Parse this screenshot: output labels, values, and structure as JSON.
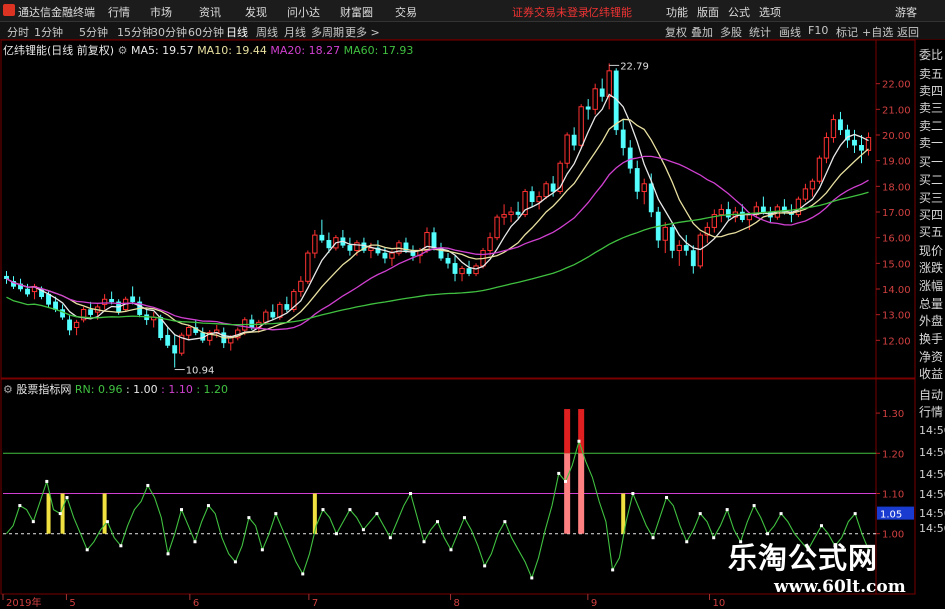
{
  "menubar": {
    "app_title": "通达信金融终端",
    "items": [
      "行情",
      "市场",
      "资讯",
      "发现",
      "问小达",
      "财富圈",
      "交易"
    ],
    "warning": "证券交易未登录",
    "warning2": "亿纬锂能",
    "right_items": [
      "功能",
      "版面",
      "公式",
      "选项"
    ],
    "guest": "游客"
  },
  "toolbar": {
    "periods": [
      "分时",
      "1分钟",
      "5分钟",
      "15分钟",
      "30分钟",
      "60分钟",
      "日线",
      "周线",
      "月线",
      "多周期",
      "更多 >"
    ],
    "active_period": "日线",
    "tools": [
      "复权",
      "叠加",
      "多股",
      "统计",
      "画线",
      "F10",
      "标记",
      "+自选",
      "返回"
    ]
  },
  "main_legend": {
    "stock": "亿纬锂能",
    "mode": "(日线 前复权)",
    "ma": [
      {
        "label": "MA5: 19.57",
        "color": "#e8e8e8"
      },
      {
        "label": "MA10: 19.44",
        "color": "#e8e0a0"
      },
      {
        "label": "MA20: 18.27",
        "color": "#d040d0"
      },
      {
        "label": "MA60: 17.93",
        "color": "#40c040"
      }
    ]
  },
  "sub_legend": {
    "name": "股票指标网",
    "values": [
      {
        "label": "RN: 0.96",
        "color": "#40c040"
      },
      {
        "label": ": 1.00",
        "color": "#e8e8e8"
      },
      {
        "label": ": 1.10",
        "color": "#d040d0"
      },
      {
        "label": ": 1.20",
        "color": "#40c040"
      }
    ]
  },
  "right_panel": {
    "items": [
      "委比",
      "卖五",
      "卖四",
      "卖三",
      "卖二",
      "卖一",
      "买一",
      "买二",
      "买三",
      "买四",
      "买五",
      "现价",
      "涨跌",
      "涨幅",
      "总量",
      "外盘",
      "换手",
      "净资",
      "收益"
    ],
    "items2": [
      "自动",
      "行情"
    ],
    "times": [
      "14:50",
      "14:50",
      "14:50",
      "14:50",
      "14:50",
      "14:50"
    ]
  },
  "watermark": {
    "line1": "乐淘公式网",
    "line2": "www.60lt.com"
  },
  "chart_data": [
    {
      "type": "candlestick",
      "title": "亿纬锂能 (日线 前复权)",
      "y_axis_ticks": [
        12.0,
        13.0,
        14.0,
        15.0,
        16.0,
        17.0,
        18.0,
        19.0,
        20.0,
        21.0,
        22.0
      ],
      "ylim": [
        11.0,
        23.0
      ],
      "x_labels": [
        "2019年",
        "5",
        "6",
        "7",
        "8",
        "9",
        "10"
      ],
      "annotations": [
        {
          "label": "22.79",
          "value": 22.79
        },
        {
          "label": "10.94",
          "value": 10.94
        }
      ],
      "ohlc": [
        [
          14.5,
          14.7,
          14.2,
          14.4
        ],
        [
          14.3,
          14.5,
          14.0,
          14.1
        ],
        [
          14.2,
          14.4,
          13.9,
          14.0
        ],
        [
          14.0,
          14.2,
          13.7,
          13.8
        ],
        [
          13.9,
          14.2,
          13.6,
          14.1
        ],
        [
          14.0,
          14.1,
          13.6,
          13.7
        ],
        [
          13.8,
          13.9,
          13.3,
          13.4
        ],
        [
          13.5,
          13.7,
          13.1,
          13.2
        ],
        [
          13.2,
          13.4,
          12.8,
          12.9
        ],
        [
          12.8,
          13.0,
          12.2,
          12.4
        ],
        [
          12.5,
          12.8,
          12.2,
          12.7
        ],
        [
          12.8,
          13.3,
          12.7,
          13.2
        ],
        [
          13.2,
          13.5,
          12.9,
          13.0
        ],
        [
          13.1,
          13.4,
          12.8,
          13.3
        ],
        [
          13.4,
          13.8,
          13.2,
          13.6
        ],
        [
          13.6,
          13.9,
          13.4,
          13.5
        ],
        [
          13.5,
          13.6,
          13.0,
          13.1
        ],
        [
          13.2,
          13.7,
          13.1,
          13.6
        ],
        [
          13.7,
          14.1,
          13.4,
          13.5
        ],
        [
          13.5,
          13.7,
          12.9,
          13.0
        ],
        [
          13.0,
          13.2,
          12.6,
          12.8
        ],
        [
          12.8,
          13.1,
          12.5,
          12.9
        ],
        [
          12.9,
          13.0,
          12.0,
          12.1
        ],
        [
          12.2,
          12.5,
          11.7,
          11.8
        ],
        [
          11.8,
          12.2,
          10.94,
          11.5
        ],
        [
          11.5,
          12.3,
          11.4,
          12.2
        ],
        [
          12.2,
          12.6,
          12.0,
          12.5
        ],
        [
          12.5,
          12.8,
          12.2,
          12.3
        ],
        [
          12.3,
          12.5,
          11.9,
          12.0
        ],
        [
          12.0,
          12.4,
          11.8,
          12.3
        ],
        [
          12.3,
          12.6,
          12.1,
          12.4
        ],
        [
          12.3,
          12.5,
          11.7,
          11.9
        ],
        [
          11.9,
          12.2,
          11.6,
          12.1
        ],
        [
          12.1,
          12.5,
          12.0,
          12.4
        ],
        [
          12.4,
          12.9,
          12.2,
          12.8
        ],
        [
          12.8,
          13.0,
          12.4,
          12.5
        ],
        [
          12.5,
          12.8,
          12.3,
          12.7
        ],
        [
          12.7,
          13.2,
          12.6,
          13.1
        ],
        [
          13.1,
          13.4,
          12.8,
          12.9
        ],
        [
          12.9,
          13.5,
          12.8,
          13.4
        ],
        [
          13.4,
          13.7,
          13.1,
          13.2
        ],
        [
          13.2,
          14.0,
          13.1,
          13.9
        ],
        [
          13.9,
          14.5,
          13.7,
          14.3
        ],
        [
          14.3,
          15.5,
          14.2,
          15.4
        ],
        [
          15.4,
          16.3,
          15.2,
          16.1
        ],
        [
          16.1,
          16.7,
          15.8,
          15.9
        ],
        [
          15.9,
          16.2,
          15.4,
          15.6
        ],
        [
          15.6,
          16.1,
          15.5,
          16.0
        ],
        [
          16.0,
          16.3,
          15.6,
          15.7
        ],
        [
          15.7,
          16.0,
          15.3,
          15.5
        ],
        [
          15.5,
          15.9,
          15.3,
          15.8
        ],
        [
          15.8,
          16.0,
          15.4,
          15.5
        ],
        [
          15.5,
          15.8,
          15.2,
          15.6
        ],
        [
          15.6,
          15.9,
          15.3,
          15.4
        ],
        [
          15.4,
          15.6,
          15.0,
          15.2
        ],
        [
          15.2,
          15.5,
          14.9,
          15.4
        ],
        [
          15.4,
          15.9,
          15.3,
          15.8
        ],
        [
          15.8,
          16.0,
          15.4,
          15.5
        ],
        [
          15.5,
          15.7,
          15.1,
          15.3
        ],
        [
          15.3,
          15.6,
          15.0,
          15.5
        ],
        [
          15.5,
          16.4,
          15.4,
          16.2
        ],
        [
          16.2,
          16.4,
          15.5,
          15.6
        ],
        [
          15.6,
          15.8,
          15.1,
          15.2
        ],
        [
          15.2,
          15.4,
          14.8,
          15.0
        ],
        [
          15.0,
          15.3,
          14.3,
          14.6
        ],
        [
          14.6,
          14.9,
          14.3,
          14.8
        ],
        [
          14.8,
          15.1,
          14.5,
          14.6
        ],
        [
          14.6,
          15.0,
          14.5,
          14.9
        ],
        [
          14.9,
          15.6,
          14.8,
          15.5
        ],
        [
          15.5,
          16.2,
          15.3,
          16.0
        ],
        [
          16.0,
          16.9,
          15.9,
          16.8
        ],
        [
          16.8,
          17.3,
          16.5,
          16.9
        ],
        [
          16.9,
          17.2,
          16.6,
          17.0
        ],
        [
          17.0,
          17.4,
          16.7,
          16.9
        ],
        [
          16.9,
          17.9,
          16.8,
          17.8
        ],
        [
          17.8,
          18.0,
          17.2,
          17.4
        ],
        [
          17.4,
          17.8,
          17.1,
          17.6
        ],
        [
          17.6,
          18.2,
          17.5,
          18.1
        ],
        [
          18.1,
          18.4,
          17.6,
          17.8
        ],
        [
          17.8,
          19.0,
          17.7,
          18.9
        ],
        [
          18.9,
          20.1,
          18.7,
          20.0
        ],
        [
          20.0,
          20.3,
          19.4,
          19.6
        ],
        [
          19.6,
          21.2,
          19.5,
          21.1
        ],
        [
          21.1,
          21.4,
          20.6,
          21.0
        ],
        [
          21.0,
          22.0,
          20.8,
          21.8
        ],
        [
          21.8,
          22.2,
          21.3,
          21.5
        ],
        [
          21.5,
          22.79,
          21.0,
          22.5
        ],
        [
          22.5,
          22.6,
          20.0,
          20.2
        ],
        [
          20.2,
          20.6,
          19.2,
          19.5
        ],
        [
          19.5,
          19.8,
          18.5,
          18.7
        ],
        [
          18.7,
          19.0,
          17.5,
          17.8
        ],
        [
          17.8,
          18.3,
          17.3,
          18.1
        ],
        [
          18.1,
          18.5,
          16.8,
          17.0
        ],
        [
          17.0,
          17.2,
          15.6,
          15.9
        ],
        [
          15.9,
          16.6,
          15.4,
          16.4
        ],
        [
          16.4,
          16.5,
          15.2,
          15.5
        ],
        [
          15.5,
          15.9,
          14.9,
          15.7
        ],
        [
          15.7,
          16.1,
          15.3,
          15.5
        ],
        [
          15.5,
          15.7,
          14.6,
          14.9
        ],
        [
          14.9,
          16.2,
          14.8,
          16.1
        ],
        [
          16.1,
          16.6,
          15.8,
          16.4
        ],
        [
          16.4,
          17.1,
          16.2,
          16.9
        ],
        [
          16.9,
          17.3,
          16.6,
          17.1
        ],
        [
          17.1,
          17.4,
          16.7,
          16.8
        ],
        [
          16.8,
          17.2,
          16.6,
          17.0
        ],
        [
          17.0,
          17.3,
          16.6,
          16.7
        ],
        [
          16.7,
          17.0,
          16.3,
          16.9
        ],
        [
          16.9,
          17.4,
          16.8,
          17.2
        ],
        [
          17.2,
          17.6,
          16.9,
          17.0
        ],
        [
          17.0,
          17.2,
          16.6,
          16.8
        ],
        [
          16.8,
          17.3,
          16.7,
          17.2
        ],
        [
          17.2,
          17.5,
          16.9,
          17.0
        ],
        [
          17.0,
          17.3,
          16.6,
          16.9
        ],
        [
          16.9,
          17.6,
          16.8,
          17.5
        ],
        [
          17.5,
          18.1,
          17.4,
          17.9
        ],
        [
          17.9,
          18.3,
          17.6,
          18.2
        ],
        [
          18.2,
          19.2,
          18.1,
          19.1
        ],
        [
          19.1,
          20.1,
          18.9,
          19.9
        ],
        [
          19.9,
          20.8,
          19.7,
          20.6
        ],
        [
          20.6,
          20.9,
          20.0,
          20.2
        ],
        [
          20.2,
          20.4,
          19.5,
          19.8
        ],
        [
          19.8,
          20.2,
          19.3,
          19.6
        ],
        [
          19.6,
          20.0,
          18.9,
          19.4
        ],
        [
          19.4,
          20.1,
          19.2,
          19.9
        ]
      ]
    },
    {
      "type": "line",
      "title": "股票指标网",
      "y_axis_ticks": [
        1.0,
        1.1,
        1.2,
        1.3
      ],
      "ylim": [
        0.86,
        1.34
      ],
      "hlines": [
        {
          "label": "1.00",
          "value": 1.0,
          "color": "#e8e8e8"
        },
        {
          "label": "1.10",
          "value": 1.1,
          "color": "#d040d0"
        },
        {
          "label": "1.20",
          "value": 1.2,
          "color": "#40c040"
        }
      ],
      "current_value_label": "1.05",
      "series": [
        {
          "name": "RN",
          "color": "#40c040",
          "values": [
            1.0,
            1.02,
            1.07,
            1.06,
            1.03,
            1.08,
            1.13,
            1.06,
            1.05,
            1.09,
            1.04,
            1.0,
            0.96,
            0.98,
            1.01,
            1.03,
            0.99,
            0.97,
            1.02,
            1.06,
            1.08,
            1.12,
            1.09,
            1.04,
            0.95,
            1.0,
            1.06,
            1.02,
            0.98,
            1.03,
            1.07,
            1.05,
            0.99,
            0.95,
            0.93,
            0.97,
            1.04,
            1.02,
            0.96,
            1.0,
            1.05,
            1.01,
            0.97,
            0.93,
            0.9,
            0.95,
            1.02,
            1.06,
            1.04,
            1.0,
            1.03,
            1.06,
            1.04,
            1.01,
            1.03,
            1.05,
            1.02,
            0.99,
            1.03,
            1.07,
            1.1,
            1.04,
            0.98,
            1.01,
            1.03,
            0.99,
            0.96,
            1.0,
            1.04,
            1.01,
            0.97,
            0.92,
            0.95,
            1.0,
            1.03,
            0.99,
            0.96,
            0.93,
            0.89,
            0.94,
            1.01,
            1.07,
            1.15,
            1.13,
            1.17,
            1.23,
            1.18,
            1.14,
            1.08,
            1.03,
            0.91,
            0.94,
            1.03,
            1.1,
            1.06,
            1.02,
            0.99,
            1.04,
            1.09,
            1.07,
            1.02,
            0.98,
            1.01,
            1.05,
            1.03,
            0.99,
            1.02,
            1.06,
            1.01,
            0.98,
            1.03,
            1.07,
            1.04,
            1.0,
            1.02,
            1.05,
            1.03,
            1.0,
            0.98,
            0.96,
            0.99,
            1.02,
            1.0,
            0.97,
            0.99,
            1.03,
            1.05,
            1.0,
            0.96
          ]
        },
        {
          "name": "signal",
          "type": "bar",
          "color": "#f0e040",
          "base": 1.0,
          "indices": [
            6,
            8,
            14,
            44,
            88
          ],
          "values": [
            1.1,
            1.1,
            1.1,
            1.1,
            1.1
          ]
        },
        {
          "name": "signal-strong",
          "type": "bar",
          "color": "#ff8080",
          "base": 1.0,
          "indices": [
            80,
            82
          ],
          "values": [
            1.2,
            1.2
          ]
        },
        {
          "name": "signal-peak",
          "type": "bar",
          "color": "#e02020",
          "base": 1.2,
          "indices": [
            80,
            82
          ],
          "values": [
            1.31,
            1.31
          ]
        }
      ]
    }
  ]
}
